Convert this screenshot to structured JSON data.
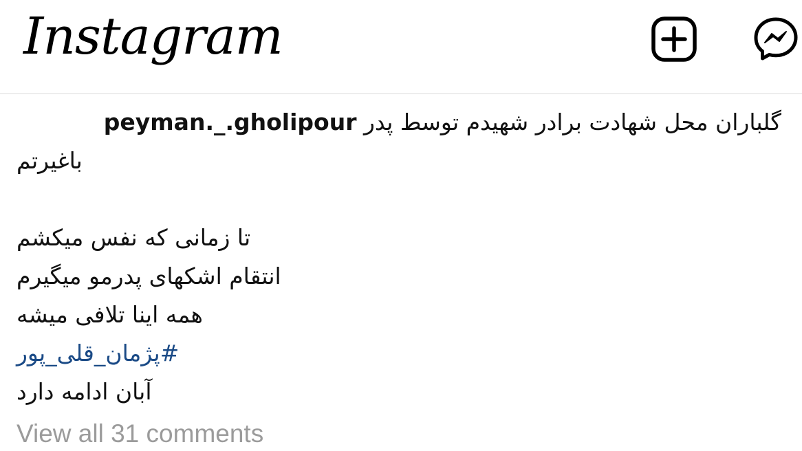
{
  "header": {
    "logo_text": "Instagram",
    "new_post_icon": "plus-square-icon",
    "messenger_icon": "messenger-icon"
  },
  "post": {
    "username": "peyman._.gholipour",
    "caption_line1": "گلباران محل شهادت برادر شهیدم توسط پدر",
    "caption_line2": "باغیرتم",
    "stanza": [
      "تا زمانی که نفس میکشم",
      "انتقام اشکهای پدرمو میگیرم",
      "همه اینا تلافی میشه"
    ],
    "hashtag": "#پژمان_قلی_پور",
    "closing_line": "آبان ادامه دارد",
    "view_comments": "View all 31 comments"
  },
  "colors": {
    "hashtag": "#1a4a86",
    "muted_text": "#9b9b9b",
    "divider": "#dcdcdc"
  }
}
